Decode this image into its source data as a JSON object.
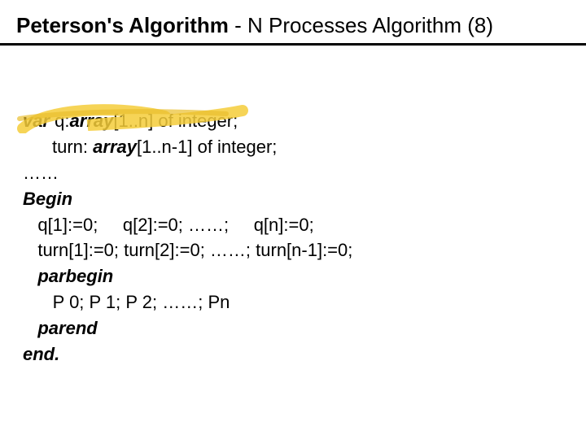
{
  "title": {
    "bold": "Peterson's Algorithm",
    "rest": " - N Processes Algorithm (8)"
  },
  "code": {
    "var_kw": "var",
    "q_decl_pre": " q:",
    "array_kw1": "array",
    "q_decl_post": "[1..n] of integer;",
    "turn_pre": "turn: ",
    "array_kw2": "array",
    "turn_post": "[1..n-1] of integer;",
    "dots1": "……",
    "begin_kw": "Begin",
    "q_init": "   q[1]:=0;     q[2]:=0; ……;     q[n]:=0;",
    "turn_init": "   turn[1]:=0; turn[2]:=0; ……; turn[n-1]:=0;",
    "parbegin_kw": "parbegin",
    "procs": "      P 0; P 1; P 2; ……; Pn",
    "parend_kw": "parend",
    "end_kw": "end."
  }
}
